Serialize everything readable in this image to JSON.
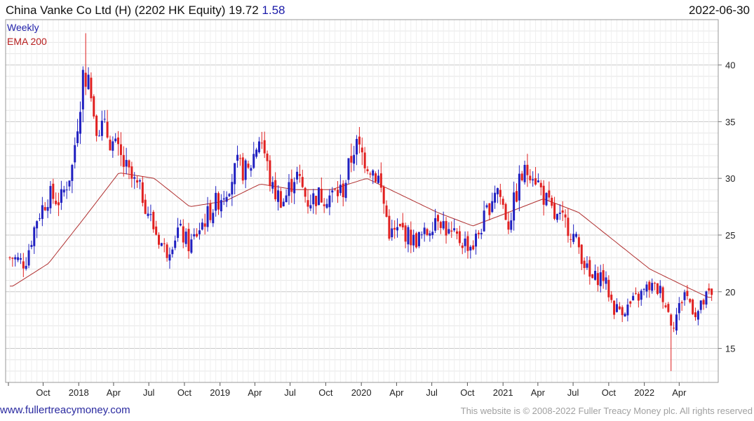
{
  "header": {
    "title": "China Vanke Co Ltd (H) (2202 HK Equity) 19.72",
    "change": "1.58",
    "date": "2022-06-30"
  },
  "legend": {
    "weekly": "Weekly",
    "ema": "EMA 200"
  },
  "footer": {
    "site": "www.fullertreacymoney.com",
    "copyright": "This website is © 2008-2022 Fuller Treacy Money plc. All rights reserved"
  },
  "colors": {
    "up": "#2020c0",
    "down": "#e02020",
    "ema": "#b03030",
    "grid": "#e6e6e6",
    "major_grid": "#c8c8c8"
  },
  "chart_data": {
    "type": "candlestick",
    "title": "China Vanke Co Ltd (H) (2202 HK Equity) 19.72 1.58",
    "xlabel": "",
    "ylabel": "",
    "ylim": [
      12,
      44
    ],
    "yticks": [
      15,
      20,
      25,
      30,
      35,
      40
    ],
    "grid": true,
    "x_ticks": [
      "Oct",
      "2018",
      "Apr",
      "Jul",
      "Oct",
      "2019",
      "Apr",
      "Jul",
      "Oct",
      "2020",
      "Apr",
      "Jul",
      "Oct",
      "2021",
      "Apr",
      "Jul",
      "Oct",
      "2022",
      "Apr"
    ],
    "date_range": [
      "2017-07-07",
      "2022-06-30"
    ],
    "close_keypoints": [
      [
        "2017-07",
        23.0
      ],
      [
        "2017-08",
        22.5
      ],
      [
        "2017-09",
        26.5
      ],
      [
        "2017-10",
        28.5
      ],
      [
        "2017-11",
        28.0
      ],
      [
        "2017-12",
        31.0
      ],
      [
        "2018-01",
        40.0
      ],
      [
        "2018-02",
        35.0
      ],
      [
        "2018-03",
        34.0
      ],
      [
        "2018-04",
        32.0
      ],
      [
        "2018-05",
        30.0
      ],
      [
        "2018-06",
        28.5
      ],
      [
        "2018-07",
        25.5
      ],
      [
        "2018-08",
        23.5
      ],
      [
        "2018-09",
        25.5
      ],
      [
        "2018-10",
        24.0
      ],
      [
        "2018-11",
        26.0
      ],
      [
        "2018-12",
        27.5
      ],
      [
        "2019-01",
        29.0
      ],
      [
        "2019-02",
        31.0
      ],
      [
        "2019-03",
        30.5
      ],
      [
        "2019-04",
        34.0
      ],
      [
        "2019-05",
        29.0
      ],
      [
        "2019-06",
        28.0
      ],
      [
        "2019-07",
        30.5
      ],
      [
        "2019-08",
        28.0
      ],
      [
        "2019-09",
        28.5
      ],
      [
        "2019-10",
        28.5
      ],
      [
        "2019-11",
        29.0
      ],
      [
        "2019-12",
        33.0
      ],
      [
        "2020-01",
        31.5
      ],
      [
        "2020-02",
        30.0
      ],
      [
        "2020-03",
        25.0
      ],
      [
        "2020-04",
        25.5
      ],
      [
        "2020-05",
        24.5
      ],
      [
        "2020-06",
        25.0
      ],
      [
        "2020-07",
        27.0
      ],
      [
        "2020-08",
        25.0
      ],
      [
        "2020-09",
        24.5
      ],
      [
        "2020-10",
        24.0
      ],
      [
        "2020-11",
        26.5
      ],
      [
        "2020-12",
        29.5
      ],
      [
        "2021-01",
        26.0
      ],
      [
        "2021-02",
        30.0
      ],
      [
        "2021-03",
        31.0
      ],
      [
        "2021-04",
        28.5
      ],
      [
        "2021-05",
        26.5
      ],
      [
        "2021-06",
        26.0
      ],
      [
        "2021-07",
        24.0
      ],
      [
        "2021-08",
        21.0
      ],
      [
        "2021-09",
        21.5
      ],
      [
        "2021-10",
        18.5
      ],
      [
        "2021-11",
        18.5
      ],
      [
        "2021-12",
        19.5
      ],
      [
        "2022-01",
        20.5
      ],
      [
        "2022-02",
        20.0
      ],
      [
        "2022-03",
        17.0
      ],
      [
        "2022-04",
        20.0
      ],
      [
        "2022-05",
        18.0
      ],
      [
        "2022-06",
        19.72
      ]
    ],
    "extremes": {
      "high": {
        "date": "2018-01",
        "value": 42.8
      },
      "low": {
        "date": "2022-03",
        "value": 13.0
      }
    },
    "ema200_keypoints": [
      [
        "2017-07",
        20.5
      ],
      [
        "2017-10",
        22.5
      ],
      [
        "2018-01",
        26.5
      ],
      [
        "2018-04",
        30.5
      ],
      [
        "2018-07",
        30.0
      ],
      [
        "2018-10",
        27.5
      ],
      [
        "2019-01",
        28.0
      ],
      [
        "2019-04",
        29.5
      ],
      [
        "2019-07",
        29.0
      ],
      [
        "2019-10",
        29.0
      ],
      [
        "2020-01",
        30.0
      ],
      [
        "2020-04",
        28.5
      ],
      [
        "2020-07",
        27.0
      ],
      [
        "2020-10",
        25.8
      ],
      [
        "2021-01",
        27.0
      ],
      [
        "2021-04",
        28.2
      ],
      [
        "2021-07",
        27.0
      ],
      [
        "2021-10",
        24.5
      ],
      [
        "2022-01",
        22.0
      ],
      [
        "2022-04",
        20.5
      ],
      [
        "2022-06",
        19.5
      ]
    ]
  }
}
